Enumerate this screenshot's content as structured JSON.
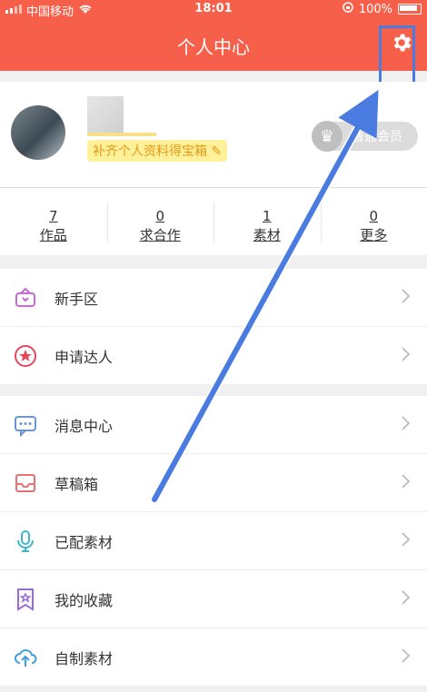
{
  "statusbar": {
    "carrier": "中国移动",
    "time": "18:01",
    "battery": "100%"
  },
  "header": {
    "title": "个人中心"
  },
  "profile": {
    "complete_link": "补齐个人资料得宝箱",
    "vip_label": "普通会员"
  },
  "stats": [
    {
      "count": "7",
      "label": "作品"
    },
    {
      "count": "0",
      "label": "求合作"
    },
    {
      "count": "1",
      "label": "素材"
    },
    {
      "count": "0",
      "label": "更多"
    }
  ],
  "menu_group1": [
    {
      "label": "新手区",
      "icon": "gift-icon"
    },
    {
      "label": "申请达人",
      "icon": "star-badge-icon"
    }
  ],
  "menu_group2": [
    {
      "label": "消息中心",
      "icon": "message-icon"
    },
    {
      "label": "草稿箱",
      "icon": "inbox-icon"
    },
    {
      "label": "已配素材",
      "icon": "microphone-icon"
    },
    {
      "label": "我的收藏",
      "icon": "bookmark-star-icon"
    },
    {
      "label": "自制素材",
      "icon": "cloud-upload-icon"
    }
  ],
  "colors": {
    "brand": "#f6604a",
    "annotation": "#4a7be0"
  }
}
